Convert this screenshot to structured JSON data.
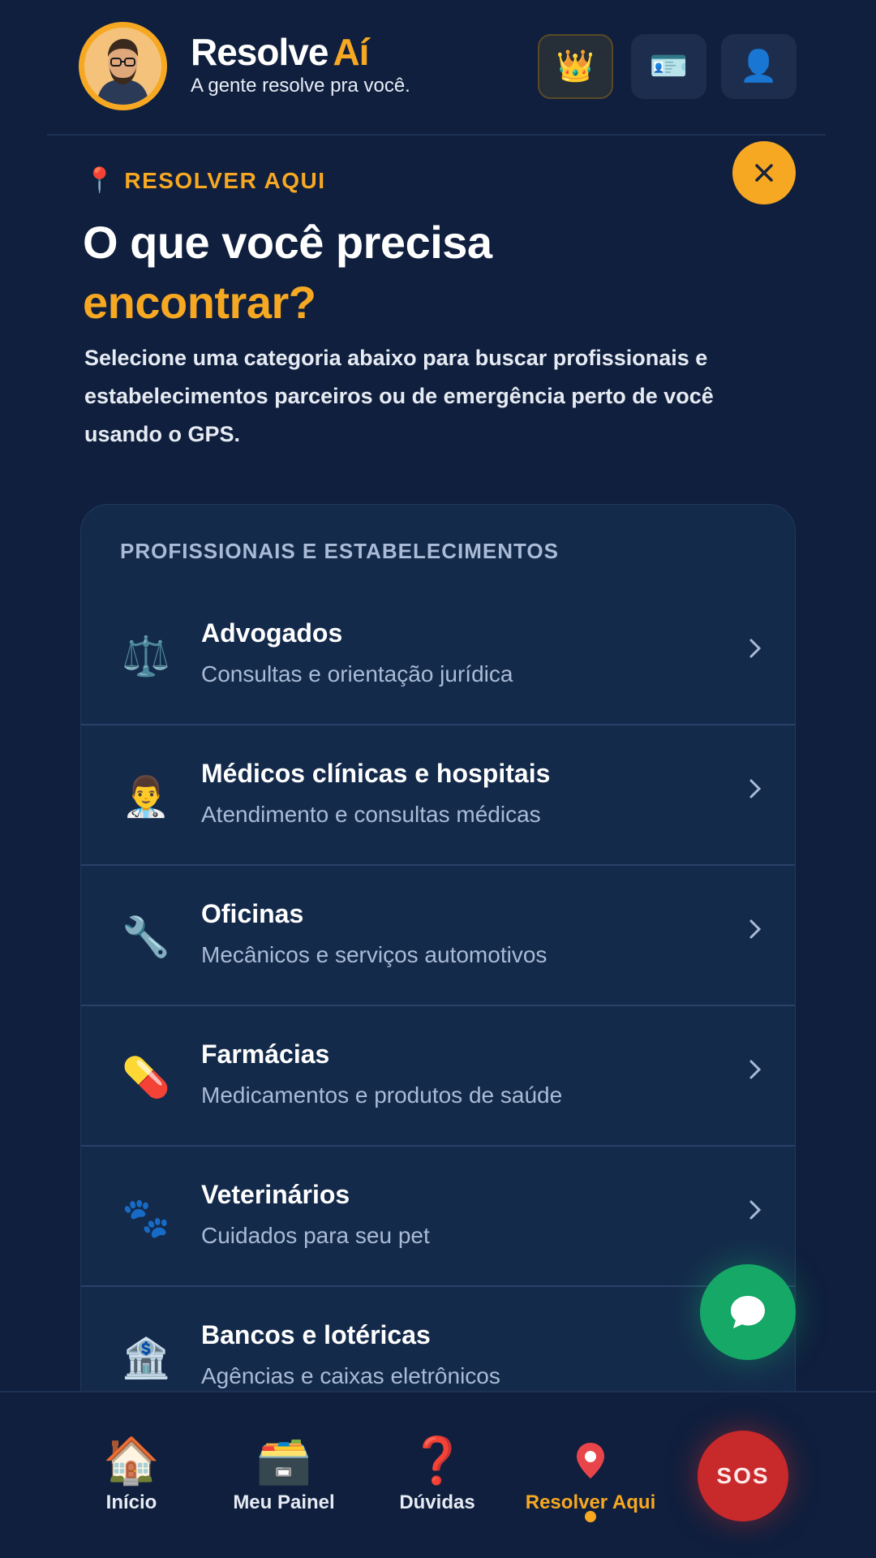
{
  "header": {
    "brand_name": "Resolve",
    "brand_accent": "Aí",
    "tagline": "A gente resolve pra você.",
    "buttons": [
      {
        "name": "premium",
        "icon": "crown-icon",
        "glyph": "👑"
      },
      {
        "name": "id-card",
        "icon": "id-card-icon",
        "glyph": "🪪"
      },
      {
        "name": "profile",
        "icon": "user-icon",
        "glyph": "👤"
      }
    ]
  },
  "hero": {
    "eyebrow": "RESOLVER AQUI",
    "eyebrow_icon": "📍",
    "title_line1": "O que você precisa",
    "title_line2": "encontrar?",
    "subtitle": "Selecione uma categoria abaixo para buscar profissionais e estabelecimentos parceiros ou de emergência perto de você usando o GPS."
  },
  "list": {
    "section_title": "PROFISSIONAIS E ESTABELECIMENTOS",
    "items": [
      {
        "title": "Advogados",
        "subtitle": "Consultas e orientação jurídica",
        "icon": "scales-icon",
        "glyph": "⚖️"
      },
      {
        "title": "Médicos clínicas e hospitais",
        "subtitle": "Atendimento e consultas médicas",
        "icon": "doctor-icon",
        "glyph": "👨‍⚕️"
      },
      {
        "title": "Oficinas",
        "subtitle": "Mecânicos e serviços automotivos",
        "icon": "wrench-icon",
        "glyph": "🔧"
      },
      {
        "title": "Farmácias",
        "subtitle": "Medicamentos e produtos de saúde",
        "icon": "pill-icon",
        "glyph": "💊"
      },
      {
        "title": "Veterinários",
        "subtitle": "Cuidados para seu pet",
        "icon": "paw-icon",
        "glyph": "🐾"
      },
      {
        "title": "Bancos e lotéricas",
        "subtitle": "Agências e caixas eletrônicos",
        "icon": "bank-icon",
        "glyph": "🏦"
      }
    ]
  },
  "nav": {
    "items": [
      {
        "label": "Início",
        "icon": "house-icon",
        "glyph": "🏠"
      },
      {
        "label": "Meu Painel",
        "icon": "file-cabinet-icon",
        "glyph": "🗃️"
      },
      {
        "label": "Dúvidas",
        "icon": "question-icon",
        "glyph": "❓"
      },
      {
        "label": "Resolver Aqui",
        "icon": "location-pin-icon",
        "glyph": ""
      }
    ],
    "active": "Resolver Aqui",
    "sos_label": "SOS"
  },
  "colors": {
    "background": "#0f1f3d",
    "accent": "#f7a823",
    "card": "#142a4b",
    "chat_green": "#15a866",
    "sos_red": "#c8292b"
  }
}
